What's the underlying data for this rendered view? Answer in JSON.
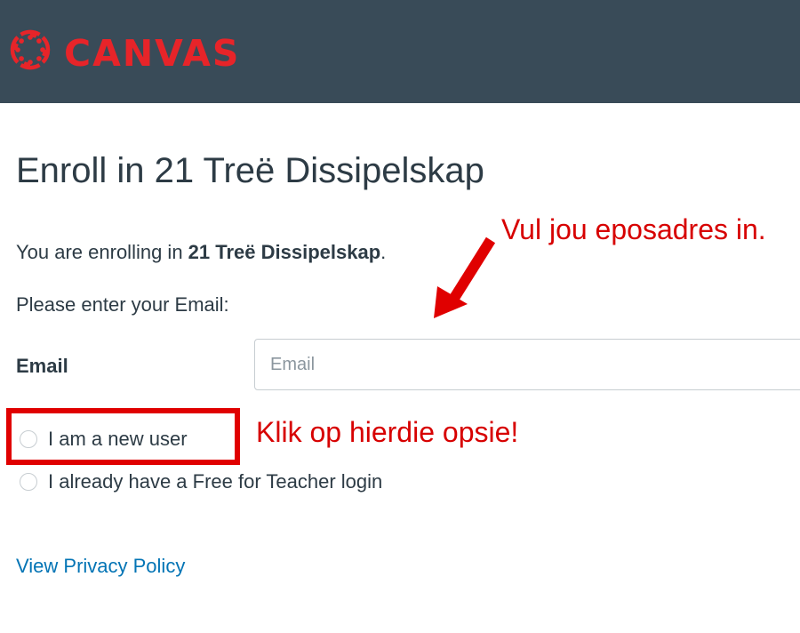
{
  "header": {
    "logo_icon": "canvas-logo-icon",
    "logo_text": "CANVAS",
    "brand_color": "#e72429",
    "background_color": "#394b58"
  },
  "page": {
    "title": "Enroll in 21 Treë Dissipelskap",
    "enrolling_prefix": "You are enrolling in ",
    "course_name": "21 Treë Dissipelskap",
    "enrolling_suffix": ".",
    "prompt": "Please enter your Email:"
  },
  "form": {
    "email_label": "Email",
    "email_placeholder": "Email",
    "email_value": "",
    "options": [
      {
        "label": "I am a new user",
        "selected": false
      },
      {
        "label": "I already have a Free for Teacher login",
        "selected": false
      }
    ]
  },
  "footer": {
    "privacy_link": "View Privacy Policy",
    "link_color": "#0374b5"
  },
  "annotations": {
    "email_hint": "Vul jou eposadres in.",
    "option_hint": "Klik op hierdie opsie!",
    "annotation_color": "#d70000",
    "arrow_icon": "red-arrow-icon"
  }
}
